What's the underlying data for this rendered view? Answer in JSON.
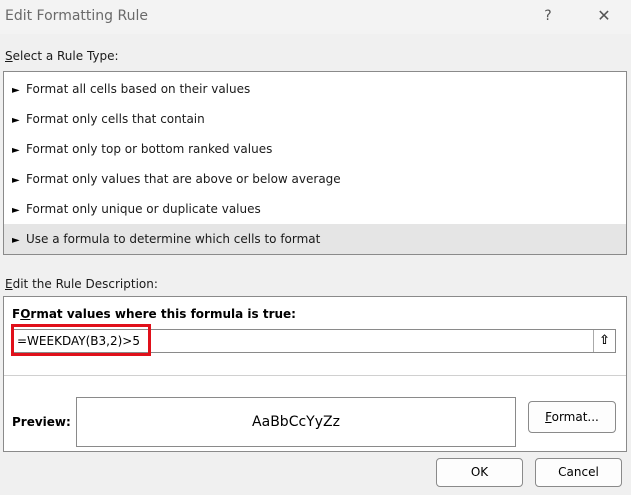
{
  "window": {
    "title": "Edit Formatting Rule",
    "help_glyph": "?",
    "close_glyph": "✕"
  },
  "rule_type": {
    "label_first": "S",
    "label_rest": "elect a Rule Type:",
    "bullet": "►",
    "items": [
      {
        "label": "Format all cells based on their values",
        "selected": false
      },
      {
        "label": "Format only cells that contain",
        "selected": false
      },
      {
        "label": "Format only top or bottom ranked values",
        "selected": false
      },
      {
        "label": "Format only values that are above or below average",
        "selected": false
      },
      {
        "label": "Format only unique or duplicate values",
        "selected": false
      },
      {
        "label": "Use a formula to determine which cells to format",
        "selected": true
      }
    ]
  },
  "description": {
    "label_first": "E",
    "label_rest": "dit the Rule Description:",
    "formula_label_first": "O",
    "formula_label_pre": "F",
    "formula_label_rest": "rmat values where this formula is true:",
    "formula_value": "=WEEKDAY(B3,2)>5",
    "collapse_icon": "⇧",
    "highlight_color": "#e0101a",
    "preview_label": "Preview:",
    "preview_sample": "AaBbCcYyZz",
    "format_button_first": "F",
    "format_button_rest": "ormat..."
  },
  "buttons": {
    "ok": "OK",
    "cancel": "Cancel"
  }
}
